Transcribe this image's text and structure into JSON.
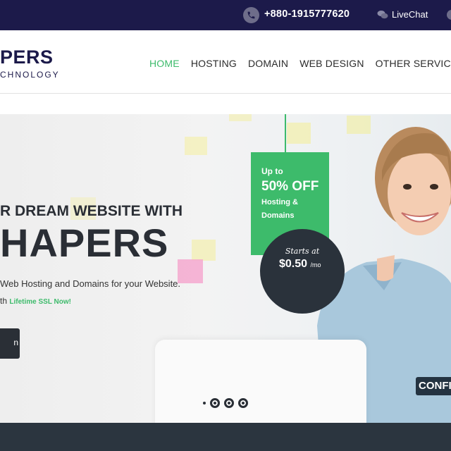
{
  "topbar": {
    "phone_icon": "phone-icon",
    "phone": "+880-1915777620",
    "chat_icon": "chat-bubbles-icon",
    "chat_label": "LiveChat"
  },
  "header": {
    "logo_main": "PERS",
    "logo_sub": "CHNOLOGY",
    "nav": [
      {
        "label": "HOME",
        "active": true
      },
      {
        "label": "HOSTING",
        "active": false
      },
      {
        "label": "DOMAIN",
        "active": false
      },
      {
        "label": "WEB DESIGN",
        "active": false
      },
      {
        "label": "OTHER SERVICE",
        "active": false
      }
    ]
  },
  "hero": {
    "line1": "R DREAM WEBSITE WITH",
    "line2": "HAPERS",
    "line3": "Web Hosting and Domains for your Website.",
    "line4_prefix": "th",
    "line4_highlight": "Lifetime SSL Now!",
    "button_label": "n",
    "promo": {
      "line1": "Up to",
      "line2": "50% OFF",
      "line3": "Hosting &",
      "line4": "Domains"
    },
    "price": {
      "starts": "Starts at",
      "value": "$0.50",
      "unit": "/mo"
    },
    "overlay_label": "CONFI",
    "carousel_dots": 3
  },
  "colors": {
    "topbar": "#1c1a4a",
    "accent_green": "#3dbb6b",
    "dark": "#2a2f36",
    "footer": "#2b353f"
  }
}
